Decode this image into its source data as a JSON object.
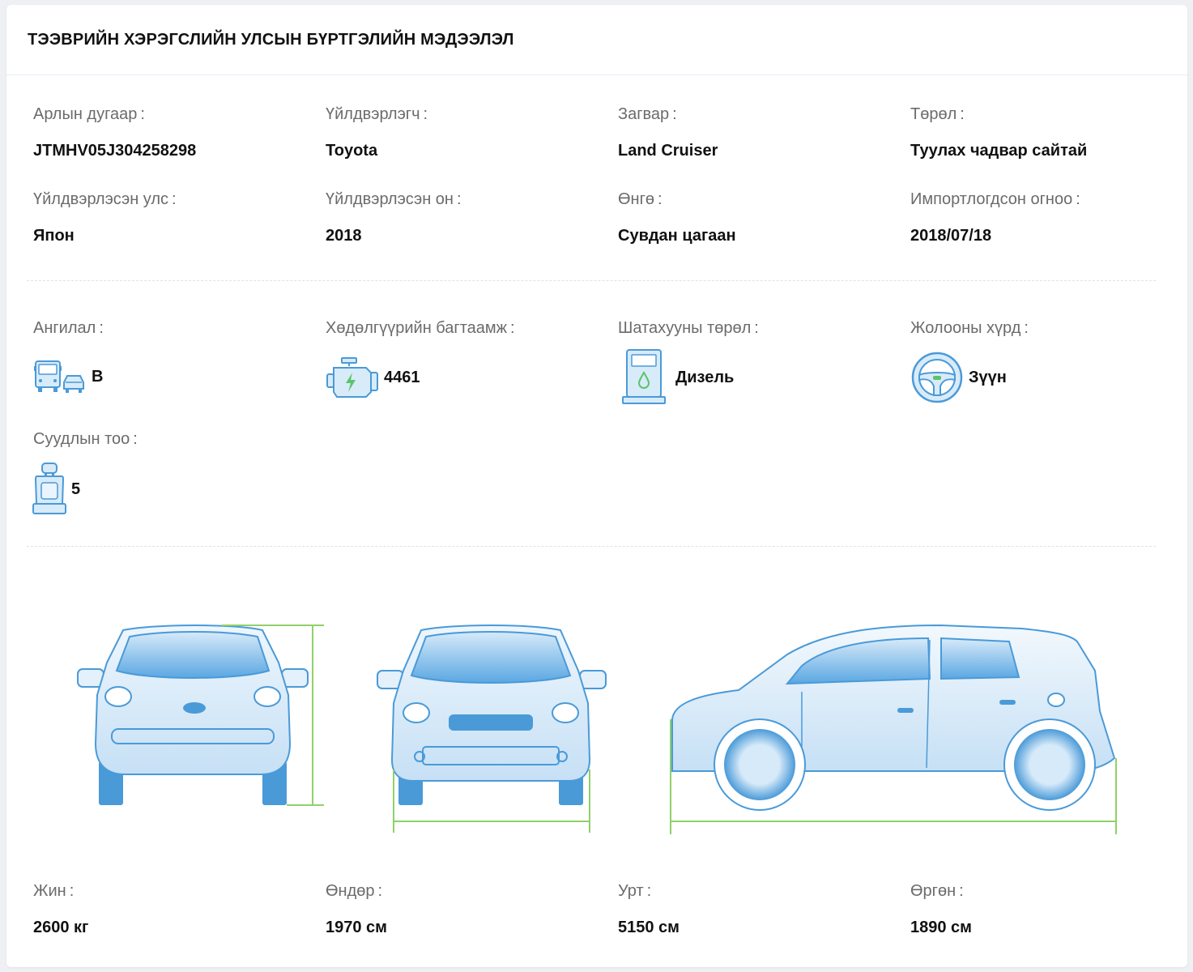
{
  "title": "ТЭЭВРИЙН ХЭРЭГСЛИЙН УЛСЫН БҮРТГЭЛИЙН МЭДЭЭЛЭЛ",
  "colon": ":",
  "info": {
    "vin_label": "Арлын дугаар",
    "vin_value": "JTMHV05J304258298",
    "make_label": "Үйлдвэрлэгч",
    "make_value": "Toyota",
    "model_label": "Загвар",
    "model_value": "Land Cruiser",
    "type_label": "Төрөл",
    "type_value": "Туулах чадвар сайтай",
    "country_label": "Үйлдвэрлэсэн улс",
    "country_value": "Япон",
    "year_label": "Үйлдвэрлэсэн он",
    "year_value": "2018",
    "color_label": "Өнгө",
    "color_value": "Сувдан цагаан",
    "import_label": "Импортлогдсон огноо",
    "import_value": "2018/07/18"
  },
  "specs": {
    "class_label": "Ангилал",
    "class_value": "B",
    "class_icon": "vehicle-class-icon",
    "engine_label": "Хөдөлгүүрийн багтаамж",
    "engine_value": "4461",
    "engine_icon": "engine-icon",
    "fuel_label": "Шатахууны төрөл",
    "fuel_value": "Дизель",
    "fuel_icon": "fuel-pump-icon",
    "steering_label": "Жолооны хүрд",
    "steering_value": "Зүүн",
    "steering_icon": "steering-wheel-icon",
    "seats_label": "Суудлын тоо",
    "seats_value": "5",
    "seats_icon": "car-seat-icon"
  },
  "dimensions": {
    "weight_label": "Жин",
    "weight_value": "2600 кг",
    "height_label": "Өндөр",
    "height_value": "1970 см",
    "length_label": "Урт",
    "length_value": "5150 см",
    "width_label": "Өргөн",
    "width_value": "1890 см"
  },
  "colors": {
    "icon_blue": "#4a9ad8",
    "icon_fill": "#d8ebf9",
    "dimension_green": "#8fd16a",
    "green_accent": "#5cc46a"
  }
}
